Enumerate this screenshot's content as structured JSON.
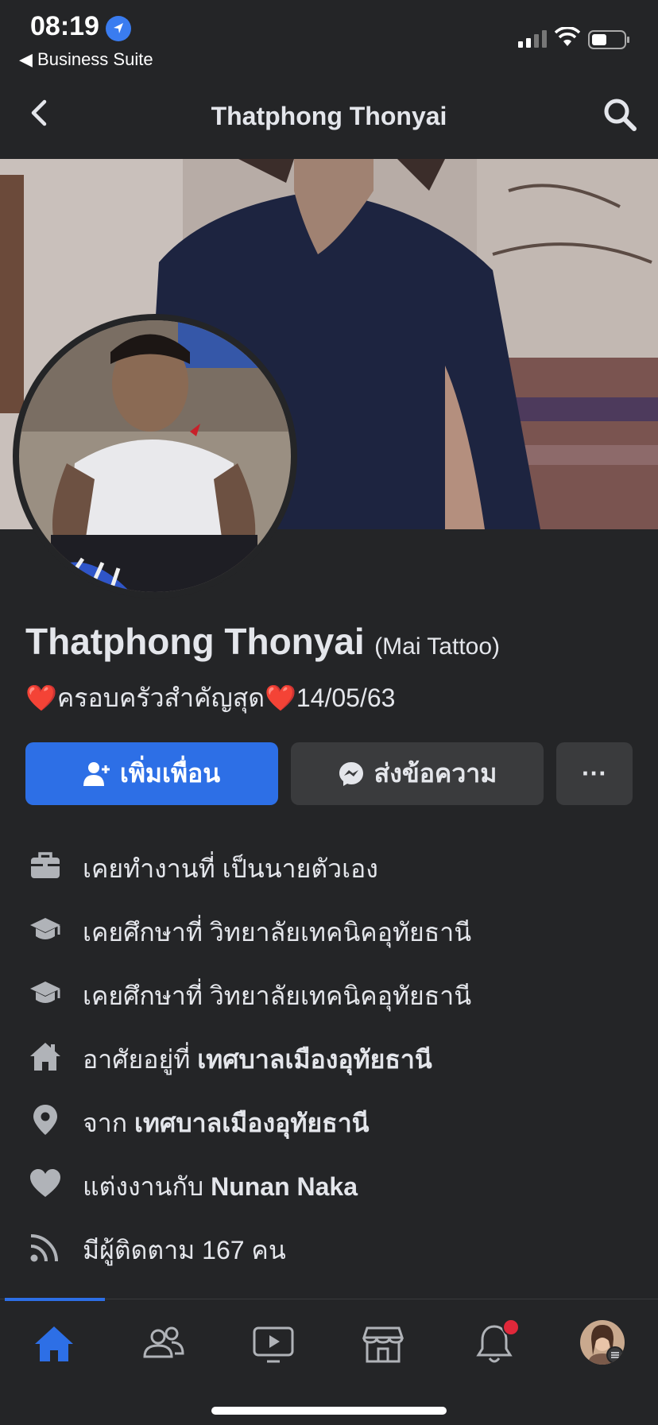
{
  "status_bar": {
    "time": "08:19",
    "back_app": "◀ Business Suite"
  },
  "nav": {
    "title": "Thatphong Thonyai"
  },
  "profile": {
    "name": "Thatphong Thonyai",
    "nickname": "(Mai Tattoo)",
    "bio_heart_1": "❤️",
    "bio_text": "ครอบครัวสำคัญสุด",
    "bio_heart_2": "❤️",
    "bio_date": "14/05/63"
  },
  "actions": {
    "add_friend": "เพิ่มเพื่อน",
    "message": "ส่งข้อความ",
    "more": "···"
  },
  "info": [
    {
      "icon": "briefcase-icon",
      "prefix": "เคยทำงานที่",
      "value": "เป็นนายตัวเอง"
    },
    {
      "icon": "graduation-cap-icon",
      "prefix": "เคยศึกษาที่",
      "value": "วิทยาลัยเทคนิคอุทัยธานี"
    },
    {
      "icon": "graduation-cap-icon",
      "prefix": "เคยศึกษาที่",
      "value": "วิทยาลัยเทคนิคอุทัยธานี"
    },
    {
      "icon": "home-icon",
      "prefix": "อาศัยอยู่ที่",
      "value": "เทศบาลเมืองอุทัยธานี"
    },
    {
      "icon": "location-pin-icon",
      "prefix": "จาก",
      "value": "เทศบาลเมืองอุทัยธานี"
    },
    {
      "icon": "heart-icon",
      "prefix": "แต่งงานกับ",
      "value": "Nunan Naka"
    },
    {
      "icon": "rss-feed-icon",
      "prefix": "มีผู้ติดตาม 167 คน",
      "value": ""
    }
  ],
  "colors": {
    "accent": "#2d6fe6",
    "background": "#242527",
    "button": "#3a3b3d",
    "notification": "#e0283a"
  }
}
